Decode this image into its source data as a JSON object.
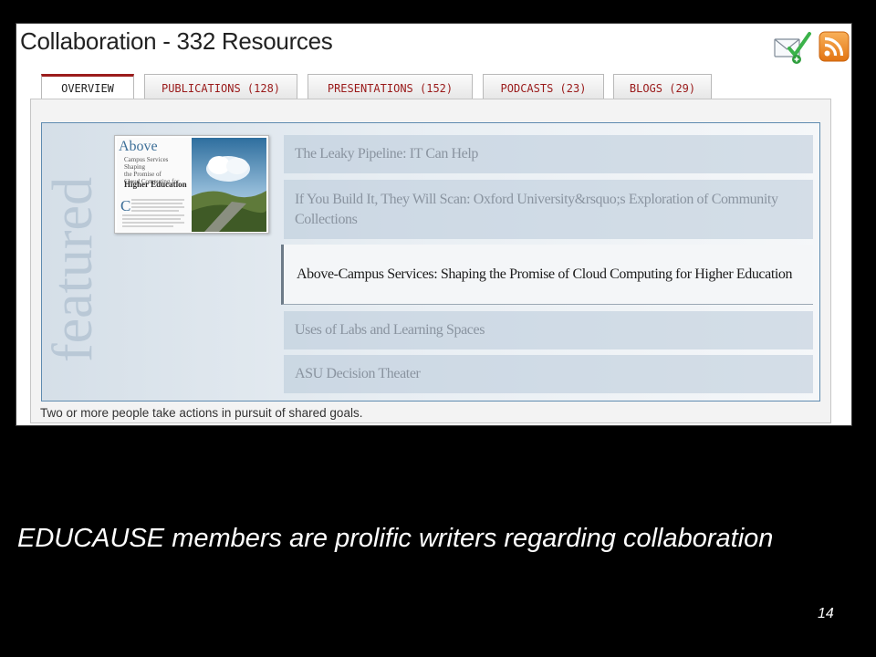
{
  "header": {
    "title": "Collaboration - 332 Resources",
    "email_icon": "email-share-icon",
    "rss_icon": "rss-feed-icon",
    "accent_color": "#9b1c1c"
  },
  "tabs": [
    {
      "label": "OVERVIEW",
      "active": true
    },
    {
      "label": "PUBLICATIONS (128)",
      "active": false
    },
    {
      "label": "PRESENTATIONS (152)",
      "active": false
    },
    {
      "label": "PODCASTS (23)",
      "active": false
    },
    {
      "label": "BLOGS (29)",
      "active": false
    }
  ],
  "featured": {
    "watermark": "featured",
    "thumbnail": {
      "title": "Above",
      "subtitle_lines": [
        "Campus Services",
        "Shaping",
        "the Promise of",
        "Cloud Computing for"
      ],
      "heading": "Higher Education",
      "initial": "C"
    },
    "items": [
      {
        "title": "The Leaky Pipeline: IT Can Help",
        "selected": false
      },
      {
        "title": "If You Build It, They Will Scan: Oxford University&rsquo;s Exploration of Community Collections",
        "selected": false
      },
      {
        "title": "Above-Campus Services: Shaping the Promise of Cloud Computing for Higher Education",
        "selected": true
      },
      {
        "title": "Uses of Labs and Learning Spaces",
        "selected": false
      },
      {
        "title": "ASU Decision Theater",
        "selected": false
      }
    ]
  },
  "description": "Two or more people take actions in pursuit of shared goals.",
  "caption": "EDUCAUSE members are prolific writers regarding collaboration",
  "slide_number": "14"
}
